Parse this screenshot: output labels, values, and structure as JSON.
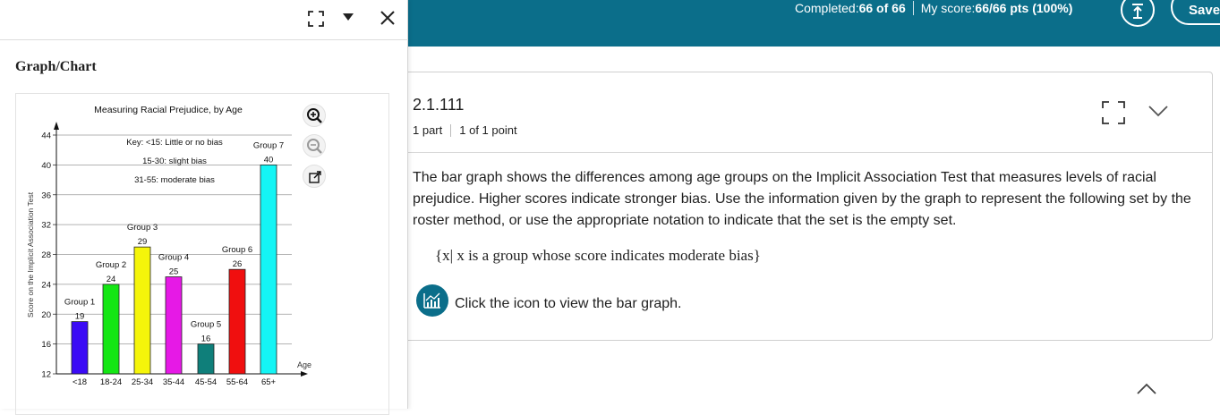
{
  "topbar": {
    "completed_label": "Completed:",
    "completed_value": "66 of 66",
    "score_label": "My score:",
    "score_value": "66/66 pts (100%)",
    "save_label": "Save",
    "bar_color": "#0b6e8a"
  },
  "question": {
    "number": "2.1.111",
    "parts": "1 part",
    "points": "1 of 1 point",
    "text": "The bar graph shows the differences among age groups on the Implicit Association Test that measures levels of racial prejudice. Higher scores indicate stronger bias. Use the information given by the graph to represent the following set by the roster method, or use the appropriate notation to indicate that the set is the empty set.",
    "set_notation": "{x| x is a group whose score indicates moderate bias}",
    "graph_hint": "Click the icon to view the bar graph."
  },
  "panel": {
    "title": "Graph/Chart"
  },
  "chart_data": {
    "type": "bar",
    "title": "Measuring Racial Prejudice, by Age",
    "xlabel": "Age",
    "ylabel": "Score on the Implicit Association Test",
    "categories": [
      "<18",
      "18-24",
      "25-34",
      "35-44",
      "45-54",
      "55-64",
      "65+"
    ],
    "group_labels": [
      "Group 1",
      "Group 2",
      "Group 3",
      "Group 4",
      "Group 5",
      "Group 6",
      "Group 7"
    ],
    "values": [
      19,
      24,
      29,
      25,
      16,
      26,
      40
    ],
    "colors": [
      "#3b0bf5",
      "#14e614",
      "#f5f50a",
      "#e619e6",
      "#0f7f7a",
      "#f00f0f",
      "#14f5f5"
    ],
    "yticks": [
      12,
      16,
      20,
      24,
      28,
      32,
      36,
      40,
      44
    ],
    "ylim": [
      12,
      44
    ],
    "key": [
      "Key: <15: Little or no bias",
      "15-30: slight bias",
      "31-55: moderate bias"
    ],
    "grid": true
  }
}
